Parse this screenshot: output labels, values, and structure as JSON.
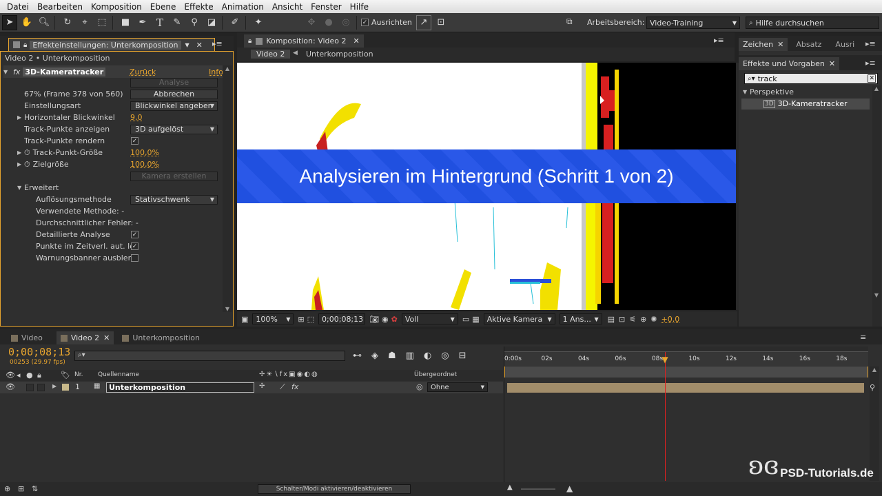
{
  "menu": [
    "Datei",
    "Bearbeiten",
    "Komposition",
    "Ebene",
    "Effekte",
    "Animation",
    "Ansicht",
    "Fenster",
    "Hilfe"
  ],
  "toolbar": {
    "align_label": "Ausrichten",
    "align_checked": true,
    "workspace_label": "Arbeitsbereich:",
    "workspace_value": "Video-Training",
    "help_placeholder": "Hilfe durchsuchen"
  },
  "effect_panel": {
    "tab_title": "Effekteinstellungen: Unterkomposition",
    "breadcrumb": "Video 2 • Unterkomposition",
    "effect_name": "3D-Kameratracker",
    "reset_label": "Zurück",
    "info_label": "Info",
    "analyse_button": "Analyse",
    "progress_text": "67% (Frame 378 von 560)",
    "cancel_button": "Abbrechen",
    "rows": {
      "setting_type_label": "Einstellungsart",
      "setting_type_value": "Blickwinkel angeben",
      "hfov_label": "Horizontaler Blickwinkel",
      "hfov_value": "9,0",
      "show_track_label": "Track-Punkte anzeigen",
      "show_track_value": "3D aufgelöst",
      "render_track_label": "Track-Punkte rendern",
      "track_size_label": "Track-Punkt-Größe",
      "track_size_value": "100,0%",
      "target_size_label": "Zielgröße",
      "target_size_value": "100,0%",
      "create_camera_button": "Kamera erstellen",
      "advanced_label": "Erweitert",
      "solve_method_label": "Auflösungsmethode",
      "solve_method_value": "Stativschwenk",
      "used_method_label": "Verwendete Methode: -",
      "avg_error_label": "Durchschnittlicher Fehler: -",
      "detailed_label": "Detaillierte Analyse",
      "auto_delete_label": "Punkte im Zeitverl. aut. lö",
      "hide_banner_label": "Warnungsbanner ausblen"
    }
  },
  "comp_panel": {
    "tab_title": "Komposition: Video 2",
    "crumb_active": "Video 2",
    "crumb_next": "Unterkomposition",
    "banner_text": "Analysieren im Hintergrund (Schritt 1 von 2)",
    "zoom": "100%",
    "timecode": "0;00;08;13",
    "resolution": "Voll",
    "camera": "Aktive Kamera",
    "views": "1 Ans...",
    "exposure": "+0,0"
  },
  "right_panel": {
    "tabs": [
      "Zeichen",
      "Absatz",
      "Ausri"
    ],
    "effects_title": "Effekte und Vorgaben",
    "search_value": "track",
    "category": "Perspektive",
    "item": "3D-Kameratracker"
  },
  "timeline": {
    "tabs": [
      "Video",
      "Video 2",
      "Unterkomposition"
    ],
    "timecode": "0;00;08;13",
    "frames": "00253 (29.97 fps)",
    "col_nr": "Nr.",
    "col_source": "Quellenname",
    "col_parent": "Übergeordnet",
    "layer_index": "1",
    "layer_name": "Unterkomposition",
    "layer_parent": "Ohne",
    "ruler": [
      "0:00s",
      "02s",
      "04s",
      "06s",
      "08s",
      "10s",
      "12s",
      "14s",
      "16s",
      "18s"
    ],
    "playhead_seconds": 8.43,
    "duration_seconds": 18.7,
    "toggle_label": "Schalter/Modi aktivieren/deaktivieren"
  },
  "watermark": "PSD-Tutorials.de",
  "colors": {
    "accent": "#e8a52e",
    "banner": "#2050e0",
    "playhead": "#e02020"
  }
}
